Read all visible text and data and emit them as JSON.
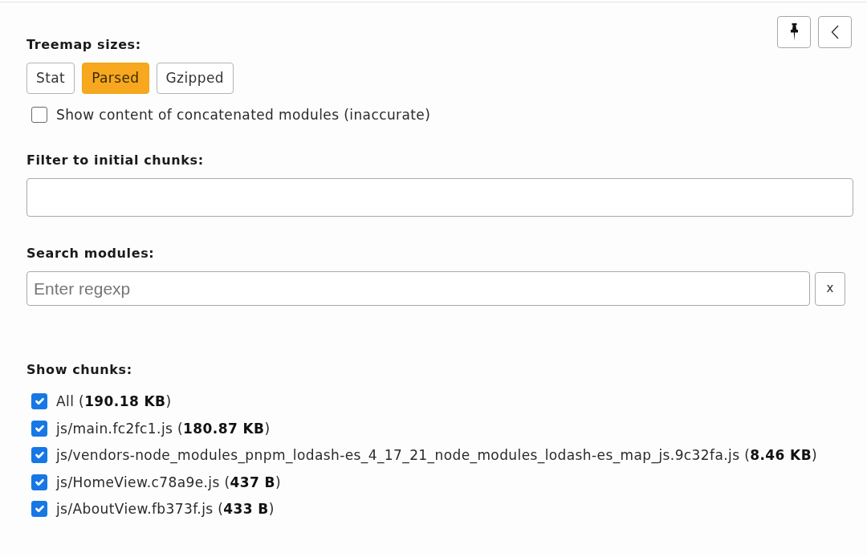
{
  "panel_buttons": [
    {
      "kind": "pin"
    },
    {
      "kind": "collapse"
    }
  ],
  "treemap_sizes": {
    "label": "Treemap sizes:",
    "options": [
      {
        "label": "Stat",
        "selected": false
      },
      {
        "label": "Parsed",
        "selected": true
      },
      {
        "label": "Gzipped",
        "selected": false
      }
    ]
  },
  "concatenated_option": {
    "label": "Show content of concatenated modules (inaccurate)",
    "checked": false
  },
  "filter": {
    "label": "Filter to initial chunks:"
  },
  "search": {
    "label": "Search modules:",
    "placeholder": "Enter regexp",
    "clear_button": "x"
  },
  "chunks": {
    "label": "Show chunks:",
    "items": [
      {
        "label": "All (**190.18 KB**)",
        "checked": true
      },
      {
        "label": "js/main.fc2fc1.js (**180.87 KB**)",
        "checked": true
      },
      {
        "label": "js/vendors-node_modules_pnpm_lodash-es_4_17_21_node_modules_lodash-es_map_js.9c32fa.js (**8.46 KB**)",
        "checked": true
      },
      {
        "label": "js/HomeView.c78a9e.js (**437 B**)",
        "checked": true
      },
      {
        "label": "js/AboutView.fb373f.js (**433 B**)",
        "checked": true
      }
    ]
  }
}
